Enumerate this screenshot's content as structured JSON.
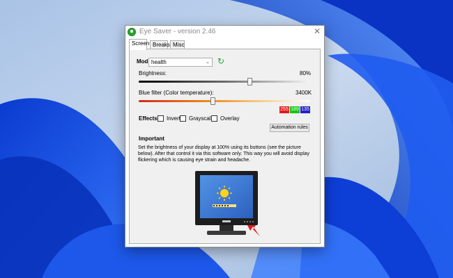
{
  "window": {
    "title": "Eye Saver - version 2.46"
  },
  "tabs": [
    {
      "label": "Screen",
      "active": true
    },
    {
      "label": "Breaks",
      "active": false
    },
    {
      "label": "Misc",
      "active": false
    }
  ],
  "mode": {
    "label": "Mode:",
    "value": "health",
    "icon": "refresh-icon"
  },
  "brightness": {
    "label": "Brightness:",
    "value_text": "80%",
    "value": 0.8
  },
  "blue_filter": {
    "label": "Blue filter (Color temperature):",
    "value_text": "3400K",
    "value": 0.45
  },
  "rgb": {
    "r": "255",
    "g": "189",
    "b": "135"
  },
  "effects": {
    "label": "Effects:",
    "items": [
      {
        "label": "Invert",
        "checked": false
      },
      {
        "label": "Grayscale",
        "checked": false
      },
      {
        "label": "Overlay",
        "checked": false
      }
    ]
  },
  "automation_button": "Automation rules",
  "important": {
    "title": "Important",
    "text": "Set the brightness of your display at 100% using its buttons (see the picture below). After that control it via this software only. This way you will avoid display flickering which is causing eye strain and headache."
  },
  "colors": {
    "accent": "#2a63d6",
    "wallpaper": "#1f4fc9",
    "panel_bg": "#f0f0f0"
  }
}
